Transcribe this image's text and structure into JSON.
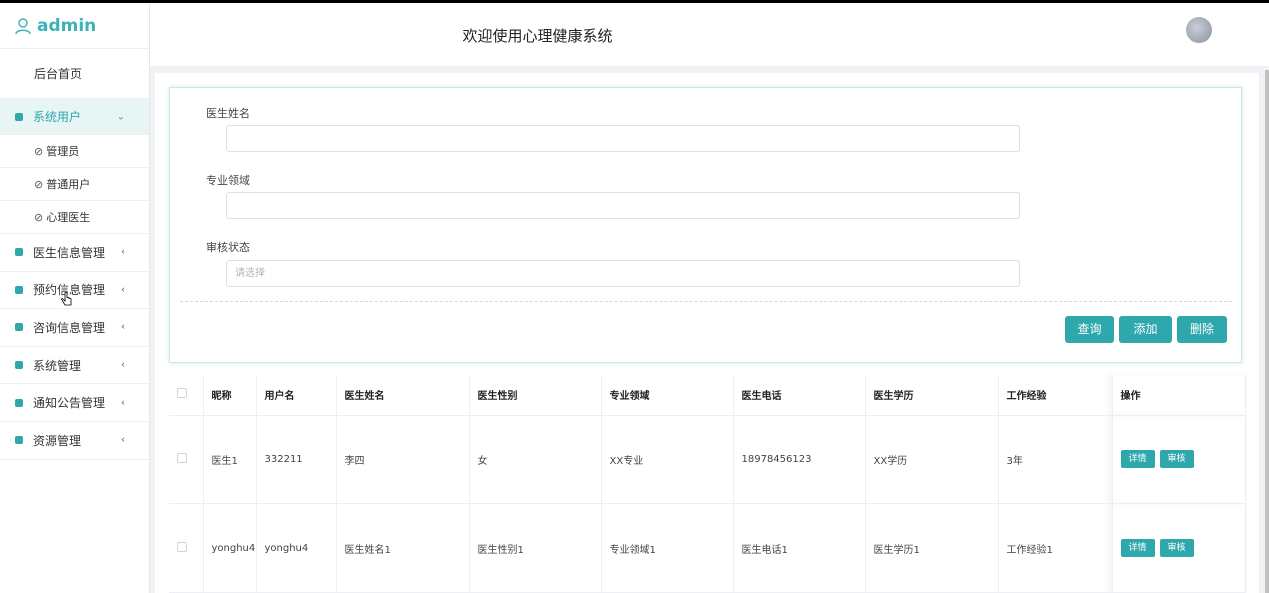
{
  "header": {
    "brand": "admin",
    "title": "欢迎使用心理健康系统"
  },
  "sidebar": {
    "home": "后台首页",
    "system_users": {
      "label": "系统用户",
      "children": [
        "管理员",
        "普通用户",
        "心理医生"
      ]
    },
    "items": [
      "医生信息管理",
      "预约信息管理",
      "咨询信息管理",
      "系统管理",
      "通知公告管理",
      "资源管理"
    ]
  },
  "search": {
    "fields": [
      {
        "label": "医生姓名",
        "value": "",
        "placeholder": ""
      },
      {
        "label": "专业领域",
        "value": "",
        "placeholder": ""
      },
      {
        "label": "审核状态",
        "value": "",
        "placeholder": "请选择"
      }
    ],
    "buttons": {
      "query": "查询",
      "add": "添加",
      "delete": "删除"
    }
  },
  "table": {
    "columns": [
      "昵称",
      "用户名",
      "医生姓名",
      "医生性别",
      "专业领域",
      "医生电话",
      "医生学历",
      "工作经验",
      "操作"
    ],
    "rows": [
      [
        "医生1",
        "332211",
        "李四",
        "女",
        "XX专业",
        "18978456123",
        "XX学历",
        "3年"
      ],
      [
        "yonghu4",
        "yonghu4",
        "医生姓名1",
        "医生性别1",
        "专业领域1",
        "医生电话1",
        "医生学历1",
        "工作经验1"
      ]
    ],
    "row_actions": {
      "detail": "详情",
      "review": "审核"
    }
  },
  "colors": {
    "accent": "#2fa8ad",
    "brand": "#3bb3b8"
  }
}
